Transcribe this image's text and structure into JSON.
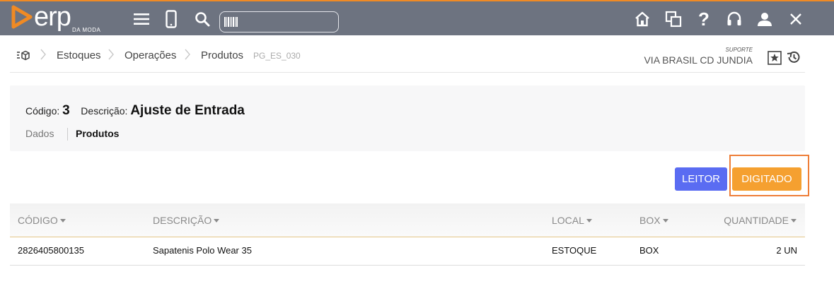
{
  "app": {
    "logo_text": "erp",
    "logo_subtext": "DA MODA"
  },
  "colors": {
    "topbar": "#6d7380",
    "accent": "#f08a24",
    "leitor_button": "#5a6cf2",
    "digitado_button": "#f5a030",
    "highlight_box": "#ee7e38"
  },
  "topbar": {
    "icons": [
      "menu-icon",
      "mobile-icon",
      "search-icon",
      "barcode-icon",
      "home-icon",
      "windows-icon",
      "help-icon",
      "headset-icon",
      "user-icon",
      "close-icon"
    ],
    "search_value": ""
  },
  "breadcrumb": {
    "items": [
      "Estoques",
      "Operações",
      "Produtos"
    ],
    "page_code": "PG_ES_030",
    "support_label": "SUPORTE",
    "store": "VIA BRASIL CD JUNDIA"
  },
  "header": {
    "code_label": "Código:",
    "code_value": "3",
    "desc_label": "Descrição:",
    "desc_value": "Ajuste de Entrada",
    "tabs": [
      "Dados",
      "Produtos"
    ],
    "active_tab": "Produtos"
  },
  "actions": {
    "leitor": "LEITOR",
    "digitado": "DIGITADO"
  },
  "table": {
    "columns": [
      "CÓDIGO",
      "DESCRIÇÃO",
      "LOCAL",
      "BOX",
      "QUANTIDADE"
    ],
    "rows": [
      [
        "2826405800135",
        "Sapatenis Polo Wear 35",
        "ESTOQUE",
        "BOX",
        "2 UN"
      ]
    ]
  }
}
